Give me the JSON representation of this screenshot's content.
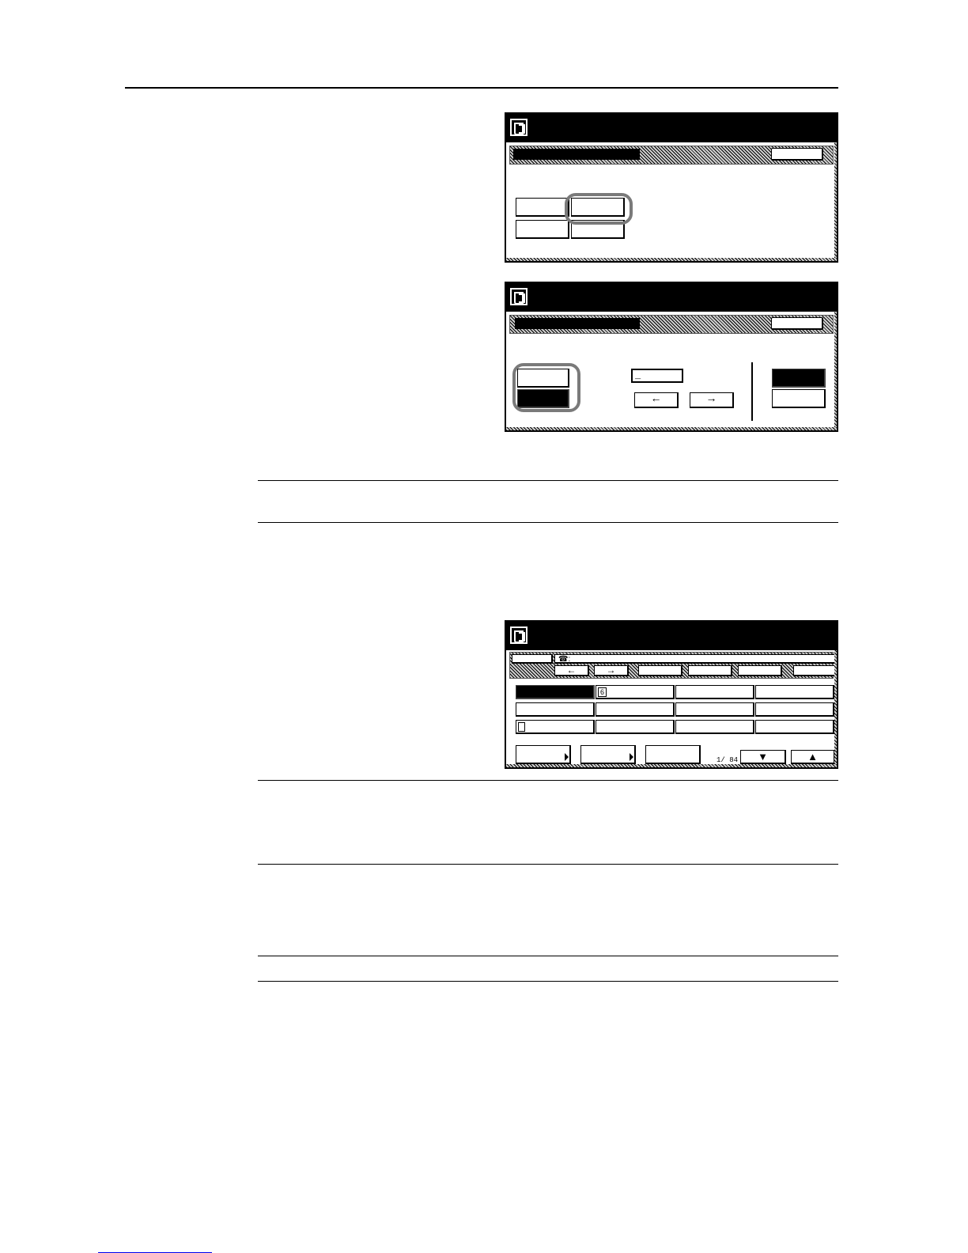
{
  "panel1": {
    "close_label": "",
    "buttons": [
      "",
      "",
      "",
      ""
    ]
  },
  "panel2": {
    "close_label": "",
    "input_value": "_",
    "left_arrow": "←",
    "right_arrow": "→"
  },
  "panel3": {
    "phone_label": "☎:",
    "left_arrow": "←",
    "right_arrow": "→",
    "tabs": [
      "",
      "",
      "",
      ""
    ],
    "entry_index_a": "6",
    "page_indicator": "1/ 84",
    "down_arrow": "▼",
    "up_arrow": "▲"
  },
  "footer": {
    "link_text": ""
  }
}
